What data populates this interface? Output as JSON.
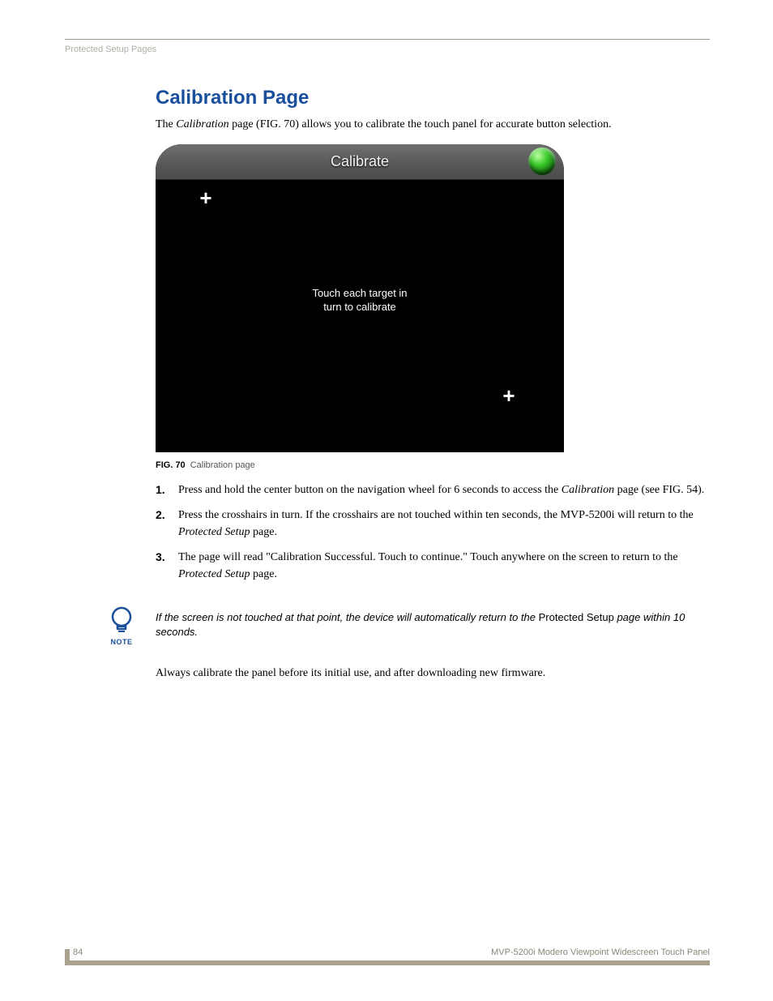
{
  "running_head": "Protected Setup Pages",
  "heading": "Calibration Page",
  "intro_pre": "The ",
  "intro_em": "Calibration",
  "intro_post": " page (FIG. 70) allows you to calibrate the touch panel for accurate button selection.",
  "figure": {
    "header": "Calibrate",
    "message_l1": "Touch each target in",
    "message_l2": "turn to calibrate",
    "caption_label": "FIG. 70",
    "caption_text": "Calibration page"
  },
  "steps": [
    {
      "pre": "Press and hold the center button on the navigation wheel for 6 seconds to access the ",
      "em": "Calibration",
      "post": " page (see FIG. 54)."
    },
    {
      "pre": "Press the crosshairs in turn. If the crosshairs are not touched within ten seconds, the MVP-5200i will return to the ",
      "em": "Protected Setup",
      "post": " page."
    },
    {
      "pre": "The page will read \"Calibration Successful. Touch to continue.\" Touch anywhere on the screen to return to the ",
      "em": "Protected Setup",
      "post": " page."
    }
  ],
  "note": {
    "label": "NOTE",
    "pre": "If the screen is not touched at that point, the device will automatically return to the ",
    "upright": "Protected Setup",
    "post": " page within 10 seconds."
  },
  "after_note": "Always calibrate the panel before its initial use, and after downloading new firmware.",
  "footer": {
    "page_number": "84",
    "doc_title": "MVP-5200i Modero Viewpoint Widescreen Touch Panel"
  }
}
